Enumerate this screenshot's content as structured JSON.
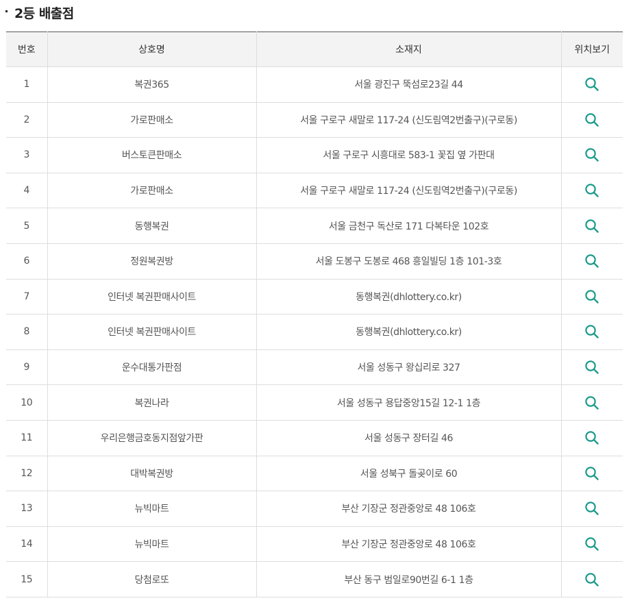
{
  "section": {
    "title": "2등 배출점"
  },
  "table": {
    "headers": {
      "number": "번호",
      "name": "상호명",
      "address": "소재지",
      "location": "위치보기"
    },
    "rows": [
      {
        "number": "1",
        "name": "복권365",
        "address": "서울 광진구 뚝섬로23길 44"
      },
      {
        "number": "2",
        "name": "가로판매소",
        "address": "서울 구로구 새말로 117-24 (신도림역2번출구)(구로동)"
      },
      {
        "number": "3",
        "name": "버스토큰판매소",
        "address": "서울 구로구 시흥대로 583-1 꽃집 옆 가판대"
      },
      {
        "number": "4",
        "name": "가로판매소",
        "address": "서울 구로구 새말로 117-24 (신도림역2번출구)(구로동)"
      },
      {
        "number": "5",
        "name": "동행복권",
        "address": "서울 금천구 독산로 171 다복타운 102호"
      },
      {
        "number": "6",
        "name": "정원복권방",
        "address": "서울 도봉구 도봉로 468 흥일빌딩 1층 101-3호"
      },
      {
        "number": "7",
        "name": "인터넷 복권판매사이트",
        "address": "동행복권(dhlottery.co.kr)"
      },
      {
        "number": "8",
        "name": "인터넷 복권판매사이트",
        "address": "동행복권(dhlottery.co.kr)"
      },
      {
        "number": "9",
        "name": "운수대통가판점",
        "address": "서울 성동구 왕십리로 327"
      },
      {
        "number": "10",
        "name": "복권나라",
        "address": "서울 성동구 용답중앙15길 12-1 1층"
      },
      {
        "number": "11",
        "name": "우리은행금호동지점앞가판",
        "address": "서울 성동구 장터길 46"
      },
      {
        "number": "12",
        "name": "대박복권방",
        "address": "서울 성북구 돌곶이로 60"
      },
      {
        "number": "13",
        "name": "뉴빅마트",
        "address": "부산 기장군 정관중앙로 48 106호"
      },
      {
        "number": "14",
        "name": "뉴빅마트",
        "address": "부산 기장군 정관중앙로 48 106호"
      },
      {
        "number": "15",
        "name": "당첨로또",
        "address": "부산 동구 범일로90번길 6-1 1층"
      }
    ],
    "location_icon": "search-icon"
  },
  "colors": {
    "accent": "#1a9a8a",
    "header_bg": "#f3f3f3",
    "border": "#dddddd",
    "top_border": "#555555"
  }
}
